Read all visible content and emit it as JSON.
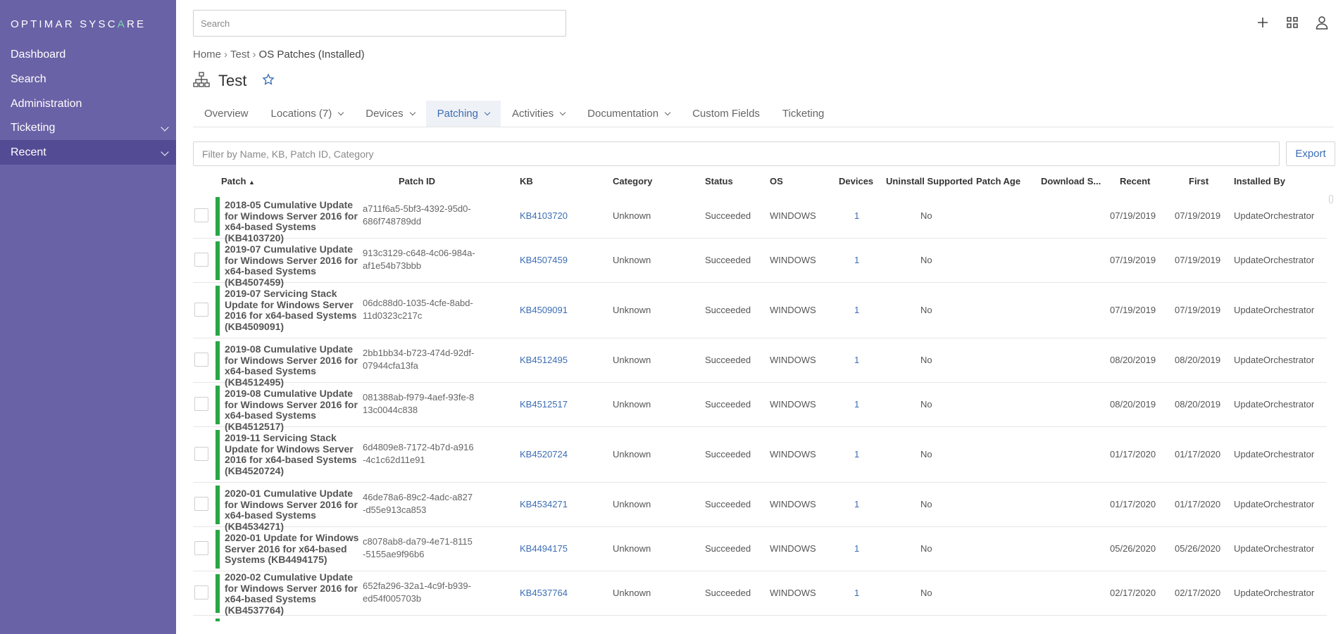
{
  "brand": {
    "pre": "OPTIMAR SYSC",
    "accent": "A",
    "post": "RE"
  },
  "sidebar": {
    "items": [
      {
        "label": "Dashboard"
      },
      {
        "label": "Search"
      },
      {
        "label": "Administration"
      },
      {
        "label": "Ticketing"
      },
      {
        "label": "Recent"
      }
    ]
  },
  "search": {
    "placeholder": "Search"
  },
  "breadcrumb": {
    "home": "Home",
    "parent": "Test",
    "current": "OS Patches (Installed)"
  },
  "page": {
    "title": "Test"
  },
  "tabs": [
    {
      "label": "Overview"
    },
    {
      "label": "Locations (7)"
    },
    {
      "label": "Devices"
    },
    {
      "label": "Patching"
    },
    {
      "label": "Activities"
    },
    {
      "label": "Documentation"
    },
    {
      "label": "Custom Fields"
    },
    {
      "label": "Ticketing"
    }
  ],
  "filter": {
    "placeholder": "Filter by Name, KB, Patch ID, Category"
  },
  "export_label": "Export",
  "columns": {
    "patch": "Patch",
    "patch_id": "Patch ID",
    "kb": "KB",
    "category": "Category",
    "status": "Status",
    "os": "OS",
    "devices": "Devices",
    "uninstall": "Uninstall Supported",
    "age": "Patch Age",
    "download": "Download S...",
    "recent": "Recent",
    "first": "First",
    "installed_by": "Installed By"
  },
  "rows": [
    {
      "name": "2018-05 Cumulative Update for Windows Server 2016 for x64-based Systems (KB4103720)",
      "id": "a711f6a5-5bf3-4392-95d0-686f748789dd",
      "kb": "KB4103720",
      "category": "Unknown",
      "status": "Succeeded",
      "os": "WINDOWS",
      "devices": "1",
      "uninstall": "No",
      "recent": "07/19/2019",
      "first": "07/19/2019",
      "by": "UpdateOrchestrator"
    },
    {
      "name": "2019-07 Cumulative Update for Windows Server 2016 for x64-based Systems (KB4507459)",
      "id": "913c3129-c648-4c06-984a-af1e54b73bbb",
      "kb": "KB4507459",
      "category": "Unknown",
      "status": "Succeeded",
      "os": "WINDOWS",
      "devices": "1",
      "uninstall": "No",
      "recent": "07/19/2019",
      "first": "07/19/2019",
      "by": "UpdateOrchestrator"
    },
    {
      "name": "2019-07 Servicing Stack Update for Windows Server 2016 for x64-based Systems (KB4509091)",
      "id": "06dc88d0-1035-4cfe-8abd-11d0323c217c",
      "kb": "KB4509091",
      "category": "Unknown",
      "status": "Succeeded",
      "os": "WINDOWS",
      "devices": "1",
      "uninstall": "No",
      "recent": "07/19/2019",
      "first": "07/19/2019",
      "by": "UpdateOrchestrator"
    },
    {
      "name": "2019-08 Cumulative Update for Windows Server 2016 for x64-based Systems (KB4512495)",
      "id": "2bb1bb34-b723-474d-92df-07944cfa13fa",
      "kb": "KB4512495",
      "category": "Unknown",
      "status": "Succeeded",
      "os": "WINDOWS",
      "devices": "1",
      "uninstall": "No",
      "recent": "08/20/2019",
      "first": "08/20/2019",
      "by": "UpdateOrchestrator"
    },
    {
      "name": "2019-08 Cumulative Update for Windows Server 2016 for x64-based Systems (KB4512517)",
      "id": "081388ab-f979-4aef-93fe-813c0044c838",
      "kb": "KB4512517",
      "category": "Unknown",
      "status": "Succeeded",
      "os": "WINDOWS",
      "devices": "1",
      "uninstall": "No",
      "recent": "08/20/2019",
      "first": "08/20/2019",
      "by": "UpdateOrchestrator"
    },
    {
      "name": "2019-11 Servicing Stack Update for Windows Server 2016 for x64-based Systems (KB4520724)",
      "id": "6d4809e8-7172-4b7d-a916-4c1c62d11e91",
      "kb": "KB4520724",
      "category": "Unknown",
      "status": "Succeeded",
      "os": "WINDOWS",
      "devices": "1",
      "uninstall": "No",
      "recent": "01/17/2020",
      "first": "01/17/2020",
      "by": "UpdateOrchestrator"
    },
    {
      "name": "2020-01 Cumulative Update for Windows Server 2016 for x64-based Systems (KB4534271)",
      "id": "46de78a6-89c2-4adc-a827-d55e913ca853",
      "kb": "KB4534271",
      "category": "Unknown",
      "status": "Succeeded",
      "os": "WINDOWS",
      "devices": "1",
      "uninstall": "No",
      "recent": "01/17/2020",
      "first": "01/17/2020",
      "by": "UpdateOrchestrator"
    },
    {
      "name": "2020-01 Update for Windows Server 2016 for x64-based Systems (KB4494175)",
      "id": "c8078ab8-da79-4e71-8115-5155ae9f96b6",
      "kb": "KB4494175",
      "category": "Unknown",
      "status": "Succeeded",
      "os": "WINDOWS",
      "devices": "1",
      "uninstall": "No",
      "recent": "05/26/2020",
      "first": "05/26/2020",
      "by": "UpdateOrchestrator"
    },
    {
      "name": "2020-02 Cumulative Update for Windows Server 2016 for x64-based Systems (KB4537764)",
      "id": "652fa296-32a1-4c9f-b939-ed54f005703b",
      "kb": "KB4537764",
      "category": "Unknown",
      "status": "Succeeded",
      "os": "WINDOWS",
      "devices": "1",
      "uninstall": "No",
      "recent": "02/17/2020",
      "first": "02/17/2020",
      "by": "UpdateOrchestrator"
    }
  ]
}
